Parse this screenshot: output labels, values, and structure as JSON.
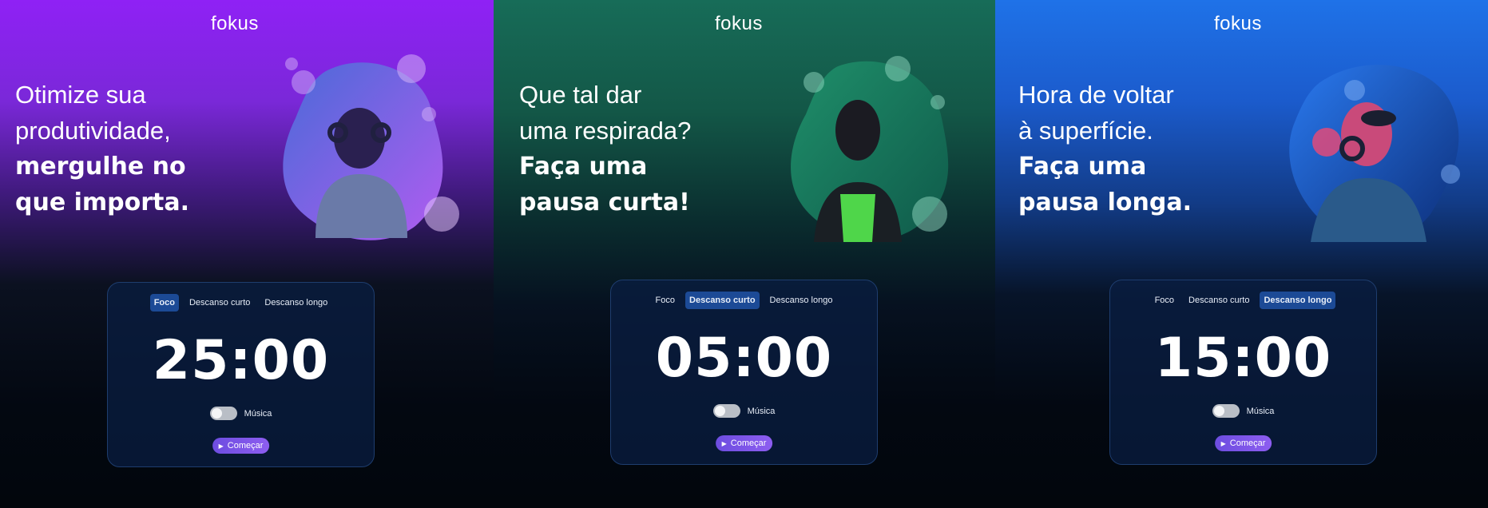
{
  "panels": [
    {
      "logo": "fokus",
      "headline": {
        "line1": "Otimize sua",
        "line2": "produtividade,",
        "line3": "mergulhe no",
        "line4": "que importa."
      },
      "tabs": [
        "Foco",
        "Descanso curto",
        "Descanso longo"
      ],
      "active_tab": "Foco",
      "timer": "25:00",
      "music_label": "Música",
      "music_on": false,
      "start_label": "Começar",
      "accent": "#8f21f5"
    },
    {
      "logo": "fokus",
      "headline": {
        "line1": "Que tal dar",
        "line2": "uma respirada?",
        "line3": "Faça uma",
        "line4": "pausa curta!"
      },
      "tabs": [
        "Foco",
        "Descanso curto",
        "Descanso longo"
      ],
      "active_tab": "Descanso curto",
      "timer": "05:00",
      "music_label": "Música",
      "music_on": false,
      "start_label": "Começar",
      "accent": "#176c58"
    },
    {
      "logo": "fokus",
      "headline": {
        "line1": "Hora de voltar",
        "line2": "à superfície.",
        "line3": "Faça uma",
        "line4": "pausa longa."
      },
      "tabs": [
        "Foco",
        "Descanso curto",
        "Descanso longo"
      ],
      "active_tab": "Descanso longo",
      "timer": "15:00",
      "music_label": "Música",
      "music_on": false,
      "start_label": "Começar",
      "accent": "#1f72e8"
    }
  ],
  "icons": {
    "play": "play-icon",
    "logo_o": "sun-icon"
  }
}
